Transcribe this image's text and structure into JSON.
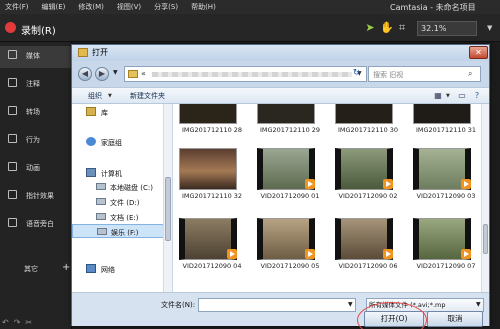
{
  "menubar": {
    "items": [
      "文件(F)",
      "编辑(E)",
      "修改(M)",
      "视图(V)",
      "分享(S)",
      "帮助(H)"
    ],
    "app_title": "Camtasia - 未命名项目"
  },
  "toolbar": {
    "record_label": "录制(R)",
    "zoom": "32.1%"
  },
  "sidebar": {
    "items": [
      {
        "label": "媒体",
        "icon": "media-icon"
      },
      {
        "label": "注释",
        "icon": "annotation-icon"
      },
      {
        "label": "转场",
        "icon": "transition-icon"
      },
      {
        "label": "行为",
        "icon": "behavior-icon"
      },
      {
        "label": "动画",
        "icon": "animation-icon"
      },
      {
        "label": "指针效果",
        "icon": "cursor-effect-icon"
      },
      {
        "label": "语音旁白",
        "icon": "microphone-icon"
      }
    ],
    "other_label": "其它",
    "add_label": "+"
  },
  "dialog": {
    "title": "打开",
    "close_label": "✕",
    "search_placeholder": "搜索 旧视",
    "organize_label": "组织",
    "new_folder_label": "新建文件夹",
    "nav_items": [
      {
        "label": "库",
        "icon": "library-icon",
        "indent": 0
      },
      {
        "label": "家庭组",
        "icon": "homegroup-icon",
        "indent": 0
      },
      {
        "label": "计算机",
        "icon": "computer-icon",
        "indent": 0
      },
      {
        "label": "本地磁盘 (C:)",
        "icon": "drive-icon",
        "indent": 1
      },
      {
        "label": "文件 (D:)",
        "icon": "drive-icon",
        "indent": 1
      },
      {
        "label": "文档 (E:)",
        "icon": "drive-icon",
        "indent": 1
      },
      {
        "label": "娱乐 (F:)",
        "icon": "drive-icon",
        "indent": 1
      },
      {
        "label": "网络",
        "icon": "network-icon",
        "indent": 0
      }
    ],
    "files": [
      {
        "name": "IMG201712110 28",
        "kind": "img",
        "color": "#2b2418"
      },
      {
        "name": "IMG201712110 29",
        "kind": "img",
        "color": "#2a2620"
      },
      {
        "name": "IMG201712110 30",
        "kind": "img",
        "color": "#242019"
      },
      {
        "name": "IMG201712110 31",
        "kind": "img",
        "color": "#1f1c18"
      },
      {
        "name": "IMG201712110 32",
        "kind": "img",
        "color": "#6f4e3a"
      },
      {
        "name": "VID201712090 01",
        "kind": "vid",
        "color": "#6e7b62"
      },
      {
        "name": "VID201712090 02",
        "kind": "vid",
        "color": "#5a6a4b"
      },
      {
        "name": "VID201712090 03",
        "kind": "vid",
        "color": "#7f8e72"
      },
      {
        "name": "VID201712090 04",
        "kind": "vid",
        "color": "#6b5d49"
      },
      {
        "name": "VID201712090 05",
        "kind": "vid",
        "color": "#8a7a60"
      },
      {
        "name": "VID201712090 06",
        "kind": "vid",
        "color": "#7c6b54"
      },
      {
        "name": "VID201712090 07",
        "kind": "vid",
        "color": "#6a7a55"
      }
    ],
    "filename_label": "文件名(N):",
    "filename_value": "",
    "filetype_value": "所有媒体文件 (*.avi;*.mp",
    "open_label": "打开(O)",
    "cancel_label": "取消"
  },
  "colors": {
    "record_red": "#e23b3b",
    "dialog_bg": "#c8d8ea",
    "highlight_circle": "#e14b4b",
    "selected_nav": "#cde3f7"
  }
}
